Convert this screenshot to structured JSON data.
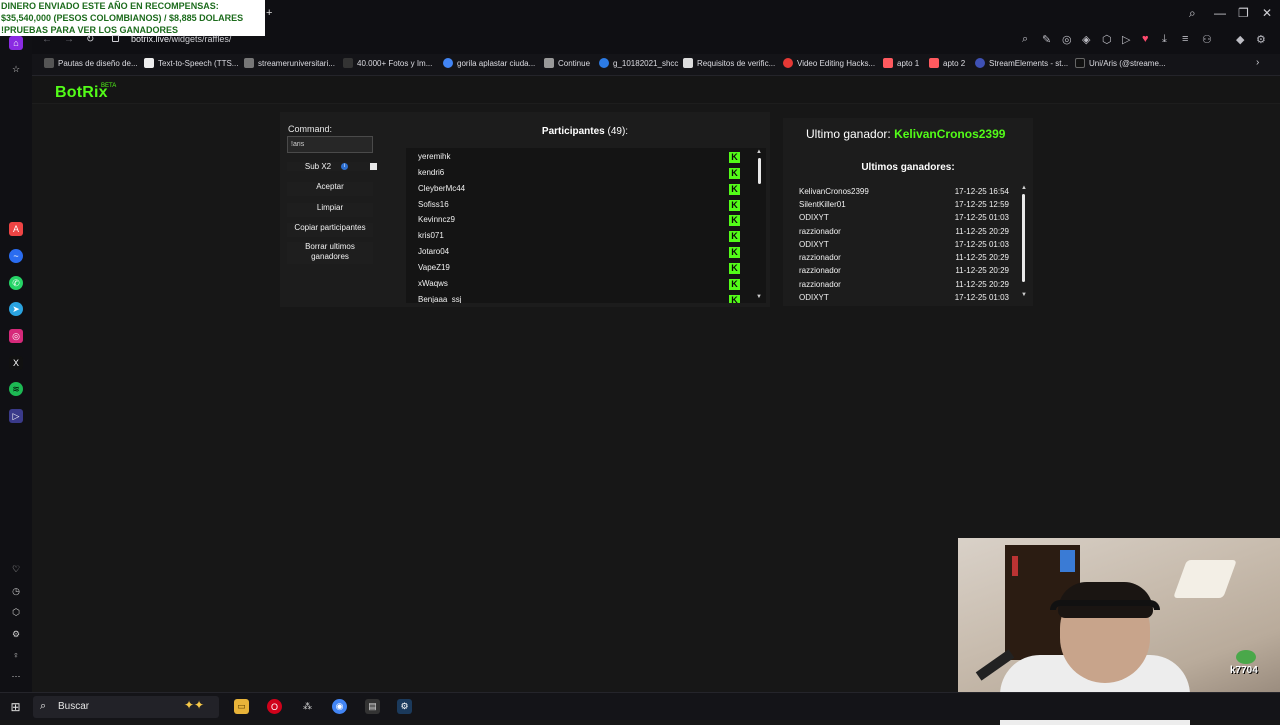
{
  "overlay": {
    "line1": "DINERO ENVIADO ESTE AÑO EN RECOMPENSAS:",
    "line2": " $35,540,000 (PESOS COLOMBIANOS) / $8,885 DOLARES",
    "line3": "!PRUEBAS PARA VER LOS GANADORES"
  },
  "browser": {
    "url_host": "botrix.live",
    "url_path": "/widgets/raffles/",
    "bookmarks": [
      {
        "label": "Pautas de diseño de...",
        "color": "#555"
      },
      {
        "label": "Text-to-Speech (TTS...",
        "color": "#eee"
      },
      {
        "label": "streameruniversitari...",
        "color": "#777"
      },
      {
        "label": "40.000+ Fotos y Im...",
        "color": "#333"
      },
      {
        "label": "gorila aplastar ciuda...",
        "color": "#4285f4"
      },
      {
        "label": "Continue",
        "color": "#999"
      },
      {
        "label": "g_10182021_shcc",
        "color": "#2c7be5"
      },
      {
        "label": "Requisitos de verific...",
        "color": "#ddd"
      },
      {
        "label": "Video Editing Hacks...",
        "color": "#e53935"
      },
      {
        "label": "apto 1",
        "color": "#ff5a5f"
      },
      {
        "label": "apto 2",
        "color": "#ff5a5f"
      },
      {
        "label": "StreamElements - st...",
        "color": "#3f51b5"
      },
      {
        "label": "Uni/Aris (@streame...",
        "color": "#111"
      }
    ]
  },
  "app": {
    "logo": "BotRix",
    "badge": "BETA"
  },
  "raffle": {
    "command_label": "Command:",
    "command_value": "!aris",
    "sub_label": "Sub X2",
    "accept_label": "Aceptar",
    "clear_label": "Limpiar",
    "copy_label": "Copiar participantes",
    "delete_label_line1": "Borrar ultimos",
    "delete_label_line2": "ganadores",
    "participants_title": "Participantes",
    "participants_count": "(49):",
    "participants": [
      "yeremihk",
      "kendri6",
      "CleyberMc44",
      "Sofiss16",
      "Kevinncz9",
      "kris071",
      "Jotaro04",
      "VapeZ19",
      "xWaqws",
      "Benjaaa_ssj"
    ]
  },
  "winners": {
    "last_label": "Ultimo ganador:",
    "last_name": "KelivanCronos2399",
    "list_title": "Ultimos ganadores:",
    "list": [
      {
        "name": "KelivanCronos2399",
        "date": "17-12-25 16:54"
      },
      {
        "name": "SilentKiller01",
        "date": "17-12-25 12:59"
      },
      {
        "name": "ODIXYT",
        "date": "17-12-25 01:03"
      },
      {
        "name": "razzionador",
        "date": "11-12-25 20:29"
      },
      {
        "name": "ODIXYT",
        "date": "17-12-25 01:03"
      },
      {
        "name": "razzionador",
        "date": "11-12-25 20:29"
      },
      {
        "name": "razzionador",
        "date": "11-12-25 20:29"
      },
      {
        "name": "razzionador",
        "date": "11-12-25 20:29"
      },
      {
        "name": "ODIXYT",
        "date": "17-12-25 01:03"
      }
    ]
  },
  "webcam": {
    "tag": "k7704"
  },
  "taskbar": {
    "search_label": "Buscar"
  },
  "colors": {
    "kick_green": "#53fc18",
    "overlay_text": "#1c6b1c"
  }
}
